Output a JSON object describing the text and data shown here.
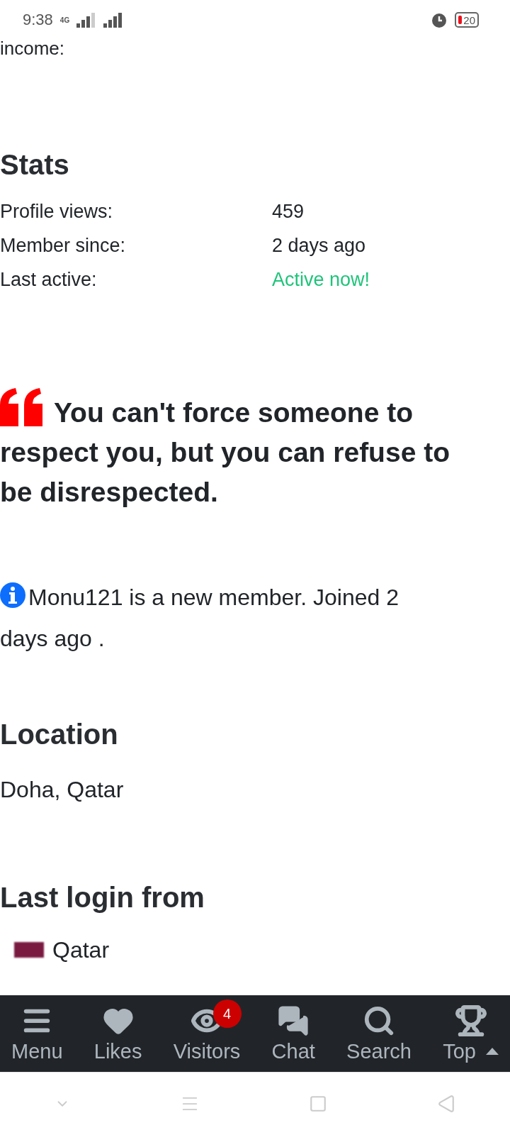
{
  "status_bar": {
    "time": "9:38",
    "network": "4G",
    "battery": "20"
  },
  "cut_text": "income:",
  "stats": {
    "title": "Stats",
    "rows": [
      {
        "label": "Profile views:",
        "value": "459",
        "kind": "plain"
      },
      {
        "label": "Member since:",
        "value": "2 days ago",
        "kind": "plain"
      },
      {
        "label": "Last active:",
        "value": "Active now!",
        "kind": "online"
      }
    ]
  },
  "quote": "You can't force someone to respect you, but you can refuse to be disrespected.",
  "notice": "Monu121 is a new member. Joined 2 days ago .",
  "location": {
    "title": "Location",
    "value": "Doha, Qatar"
  },
  "last_login": {
    "title": "Last login from",
    "country": "Qatar"
  },
  "nav": [
    {
      "label": "Menu",
      "kind": "menu",
      "caret": false
    },
    {
      "label": "Likes",
      "kind": "heart",
      "caret": false
    },
    {
      "label": "Visitors",
      "kind": "eye",
      "badge": "4",
      "caret": false
    },
    {
      "label": "Chat",
      "kind": "chat",
      "caret": false
    },
    {
      "label": "Search",
      "kind": "search",
      "caret": false
    },
    {
      "label": "Top",
      "kind": "trophy",
      "caret": true
    }
  ]
}
